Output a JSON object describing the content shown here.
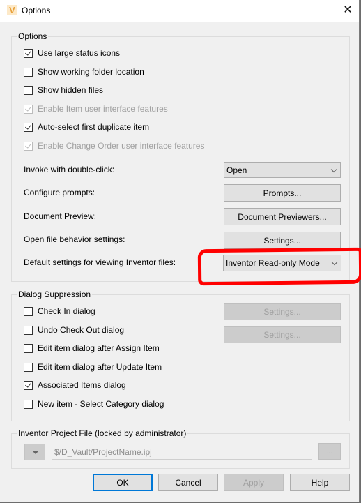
{
  "window": {
    "title": "Options",
    "app_icon": "V",
    "close_icon": "close-icon"
  },
  "options_group": {
    "legend": "Options",
    "checkboxes": [
      {
        "label": "Use large status icons",
        "checked": true,
        "disabled": false
      },
      {
        "label": "Show working folder location",
        "checked": false,
        "disabled": false
      },
      {
        "label": "Show hidden files",
        "checked": false,
        "disabled": false
      },
      {
        "label": "Enable Item user interface features",
        "checked": true,
        "disabled": true
      },
      {
        "label": "Auto-select first duplicate item",
        "checked": true,
        "disabled": false
      },
      {
        "label": "Enable Change Order user interface features",
        "checked": true,
        "disabled": true
      }
    ],
    "rows": [
      {
        "label": "Invoke with double-click:",
        "control": "select",
        "value": "Open"
      },
      {
        "label": "Configure prompts:",
        "control": "button",
        "value": "Prompts..."
      },
      {
        "label": "Document Preview:",
        "control": "button",
        "value": "Document Previewers..."
      },
      {
        "label": "Open file behavior settings:",
        "control": "button",
        "value": "Settings..."
      },
      {
        "label": "Default settings for viewing Inventor files:",
        "control": "select",
        "value": "Inventor Read-only Mode"
      }
    ]
  },
  "dialog_suppression": {
    "legend": "Dialog Suppression",
    "checkboxes": [
      {
        "label": "Check In dialog",
        "checked": false
      },
      {
        "label": "Undo Check Out dialog",
        "checked": false
      },
      {
        "label": "Edit item dialog after Assign Item",
        "checked": false
      },
      {
        "label": "Edit item dialog after Update Item",
        "checked": false
      },
      {
        "label": "Associated Items dialog",
        "checked": true
      },
      {
        "label": "New item - Select Category dialog",
        "checked": false
      }
    ],
    "settings_buttons": [
      "Settings...",
      "Settings..."
    ]
  },
  "project_file": {
    "legend": "Inventor Project File (locked by administrator)",
    "value": "$/D_Vault/ProjectName.ipj",
    "browse_label": "..."
  },
  "footer": {
    "ok": "OK",
    "cancel": "Cancel",
    "apply": "Apply",
    "help": "Help"
  },
  "annotation": {
    "color": "#ff0000",
    "target": "Default settings for viewing Inventor files"
  }
}
